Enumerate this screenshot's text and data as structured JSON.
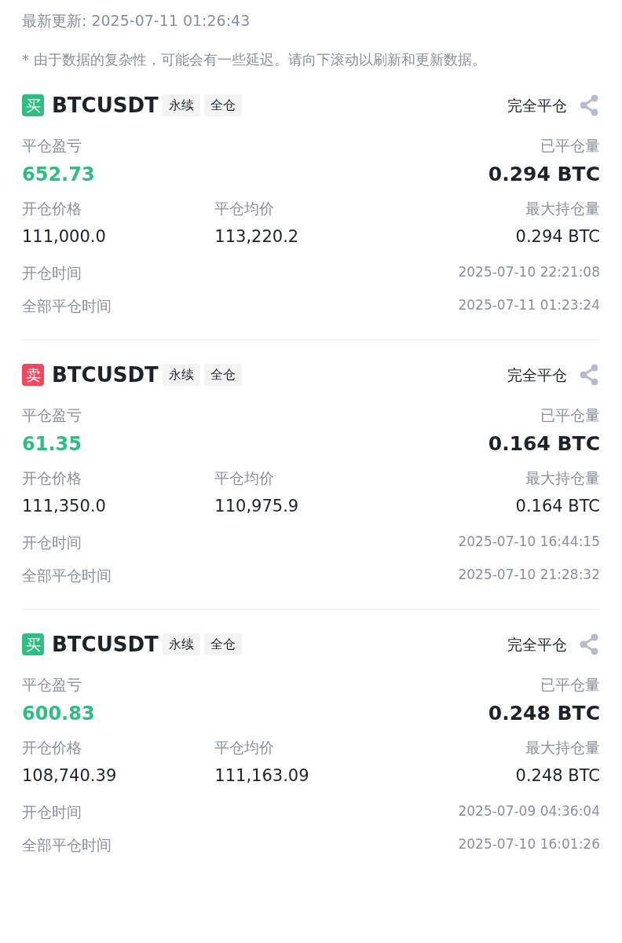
{
  "last_updated": "最新更新: 2025-07-11 01:26:43",
  "note": "* 由于数据的复杂性，可能会有一些延迟。请向下滚动以刷新和更新数据。",
  "positions": [
    {
      "side": {
        "label": "买",
        "kind": "buy"
      },
      "symbol": "BTCUSDT",
      "tags": [
        "永续",
        "全仓"
      ],
      "action": "完全平仓",
      "pnl": {
        "label": "平仓盈亏",
        "value": "652.73"
      },
      "closed_qty": {
        "label": "已平仓量",
        "value": "0.294 BTC"
      },
      "open_price": {
        "label": "开仓价格",
        "value": "111,000.0"
      },
      "close_avg": {
        "label": "平仓均价",
        "value": "113,220.2"
      },
      "max_qty": {
        "label": "最大持仓量",
        "value": "0.294 BTC"
      },
      "open_time": {
        "label": "开仓时间",
        "value": "2025-07-10 22:21:08"
      },
      "close_time": {
        "label": "全部平仓时间",
        "value": "2025-07-11 01:23:24"
      }
    },
    {
      "side": {
        "label": "卖",
        "kind": "sell"
      },
      "symbol": "BTCUSDT",
      "tags": [
        "永续",
        "全仓"
      ],
      "action": "完全平仓",
      "pnl": {
        "label": "平仓盈亏",
        "value": "61.35"
      },
      "closed_qty": {
        "label": "已平仓量",
        "value": "0.164 BTC"
      },
      "open_price": {
        "label": "开仓价格",
        "value": "111,350.0"
      },
      "close_avg": {
        "label": "平仓均价",
        "value": "110,975.9"
      },
      "max_qty": {
        "label": "最大持仓量",
        "value": "0.164 BTC"
      },
      "open_time": {
        "label": "开仓时间",
        "value": "2025-07-10 16:44:15"
      },
      "close_time": {
        "label": "全部平仓时间",
        "value": "2025-07-10 21:28:32"
      }
    },
    {
      "side": {
        "label": "买",
        "kind": "buy"
      },
      "symbol": "BTCUSDT",
      "tags": [
        "永续",
        "全仓"
      ],
      "action": "完全平仓",
      "pnl": {
        "label": "平仓盈亏",
        "value": "600.83"
      },
      "closed_qty": {
        "label": "已平仓量",
        "value": "0.248 BTC"
      },
      "open_price": {
        "label": "开仓价格",
        "value": "108,740.39"
      },
      "close_avg": {
        "label": "平仓均价",
        "value": "111,163.09"
      },
      "max_qty": {
        "label": "最大持仓量",
        "value": "0.248 BTC"
      },
      "open_time": {
        "label": "开仓时间",
        "value": "2025-07-09 04:36:04"
      },
      "close_time": {
        "label": "全部平仓时间",
        "value": "2025-07-10 16:01:26"
      }
    }
  ]
}
